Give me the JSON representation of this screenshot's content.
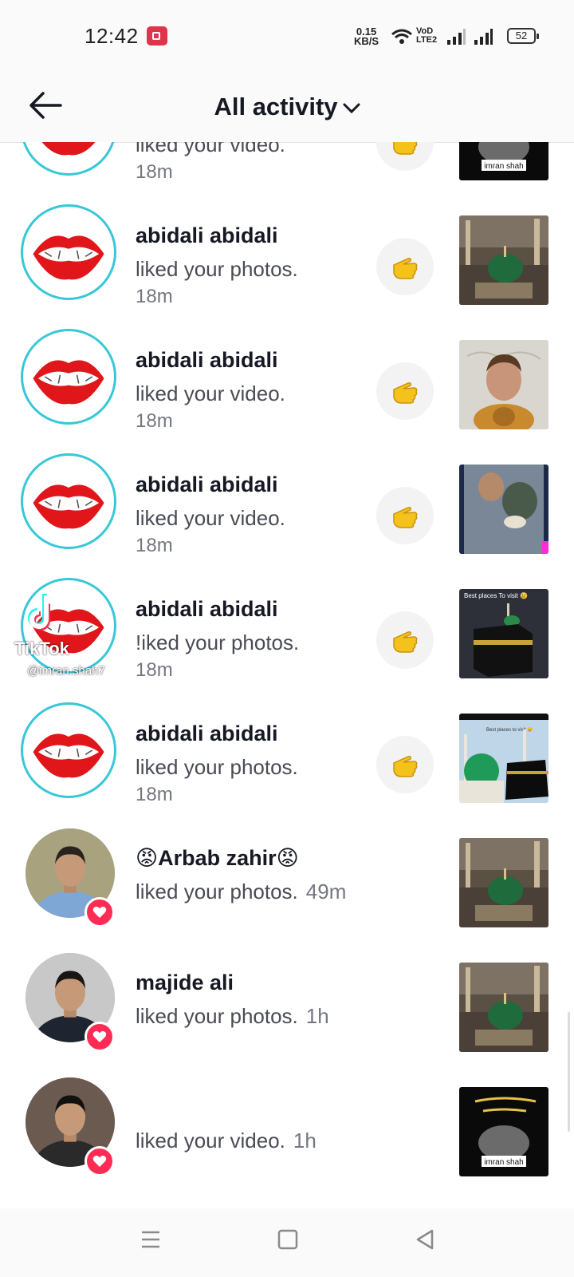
{
  "status_bar": {
    "time": "12:42",
    "net_speed_value": "0.15",
    "net_speed_unit": "KB/S",
    "volte_top": "VoD",
    "volte_bottom": "LTE2",
    "battery": "52"
  },
  "header": {
    "title": "All activity",
    "back_icon": "arrow-left-icon",
    "dropdown_icon": "chevron-down-icon"
  },
  "colors": {
    "accent": "#fe2c55",
    "ring": "#37c8d8",
    "text_secondary": "#757780"
  },
  "notifications": [
    {
      "name": "",
      "action": "liked your video.",
      "time": "18m",
      "avatar": "lips",
      "thumb": "dark-card",
      "wave": true
    },
    {
      "name": "abidali abidali",
      "action": "liked your photos.",
      "time": "18m",
      "avatar": "lips",
      "thumb": "mosque",
      "wave": true
    },
    {
      "name": "abidali abidali",
      "action": "liked your video.",
      "time": "18m",
      "avatar": "lips",
      "thumb": "portrait",
      "wave": true
    },
    {
      "name": "abidali abidali",
      "action": "liked your video.",
      "time": "18m",
      "avatar": "lips",
      "thumb": "crowd",
      "wave": true
    },
    {
      "name": "abidali abidali",
      "action": "!iked your photos.",
      "time": "18m",
      "avatar": "lips",
      "thumb": "kaaba-night",
      "wave": true
    },
    {
      "name": "abidali abidali",
      "action": "liked your photos.",
      "time": "18m",
      "avatar": "lips",
      "thumb": "mosques-pair",
      "wave": true
    },
    {
      "name": "😡Arbab zahir😡",
      "action": "liked your photos.",
      "time": "49m",
      "avatar": "person-blue",
      "thumb": "mosque",
      "wave": false
    },
    {
      "name": "majide ali",
      "action": "liked your photos.",
      "time": "1h",
      "avatar": "person-beard",
      "thumb": "mosque",
      "wave": false
    },
    {
      "name": "",
      "action": "liked your video.",
      "time": "1h",
      "avatar": "person-pair",
      "thumb": "dark-card",
      "wave": false
    }
  ],
  "thumb_text": {
    "dark_card_label": "imran shah",
    "kaaba_caption": "Best places To visit 😢",
    "mosques_caption": "Best places to visit 😢"
  },
  "watermark": {
    "brand": "TikTok",
    "user": "@imran.shah7"
  }
}
